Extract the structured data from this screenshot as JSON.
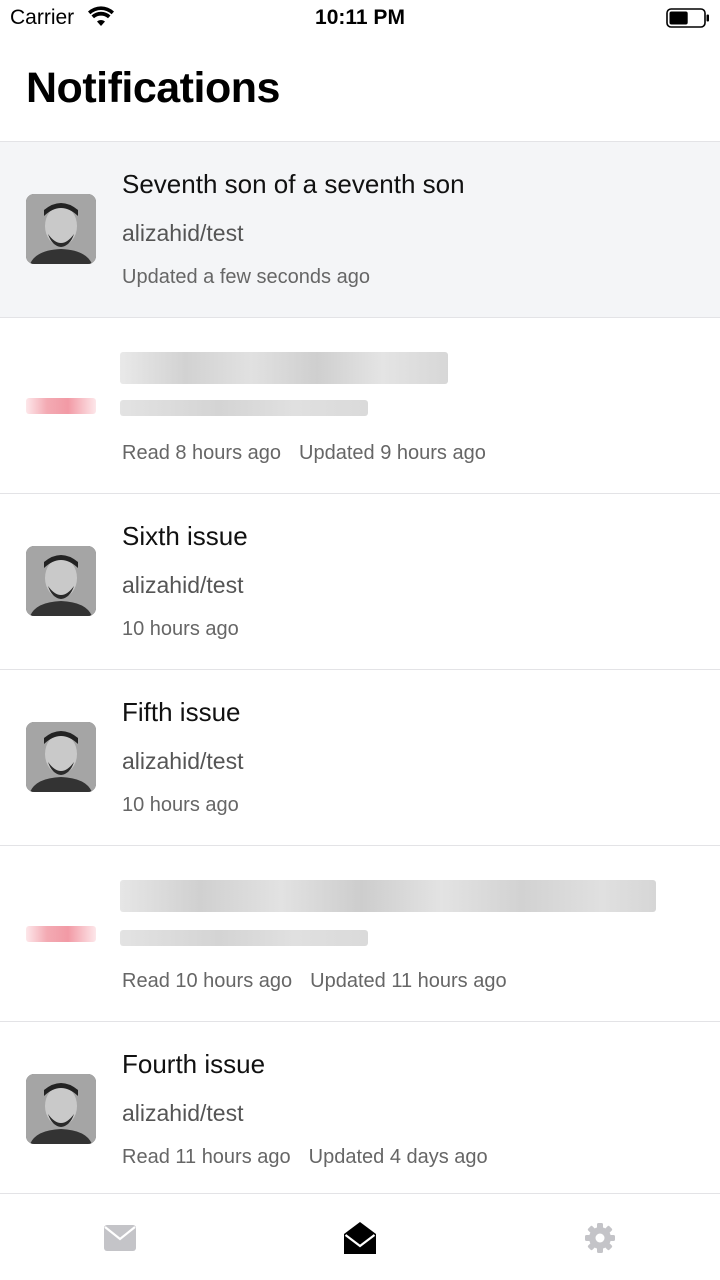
{
  "status_bar": {
    "carrier": "Carrier",
    "time": "10:11 PM",
    "battery_level": 0.55
  },
  "page": {
    "title": "Notifications"
  },
  "notifications": [
    {
      "title": "Seventh son of a seventh son",
      "repo": "alizahid/test",
      "meta_primary": "Updated a few seconds ago",
      "meta_secondary": "",
      "unread": true
    },
    {
      "title": "",
      "repo": "",
      "meta_primary": "Read 8 hours ago",
      "meta_secondary": "Updated 9 hours ago",
      "unread": false,
      "redacted": true
    },
    {
      "title": "Sixth issue",
      "repo": "alizahid/test",
      "meta_primary": "10 hours ago",
      "meta_secondary": "",
      "unread": false
    },
    {
      "title": "Fifth issue",
      "repo": "alizahid/test",
      "meta_primary": "10 hours ago",
      "meta_secondary": "",
      "unread": false
    },
    {
      "title": "",
      "repo": "",
      "meta_primary": "Read 10 hours ago",
      "meta_secondary": "Updated 11 hours ago",
      "unread": false,
      "redacted": true
    },
    {
      "title": "Fourth issue",
      "repo": "alizahid/test",
      "meta_primary": "Read 11 hours ago",
      "meta_secondary": "Updated 4 days ago",
      "unread": false
    }
  ],
  "tab_bar": {
    "tabs": [
      {
        "icon": "mail-closed-icon",
        "active": false
      },
      {
        "icon": "mail-open-icon",
        "active": true
      },
      {
        "icon": "gear-icon",
        "active": false
      }
    ],
    "active_color": "#000000",
    "inactive_color": "#c4c4c8"
  },
  "colors": {
    "unread_background": "#f4f5f7",
    "divider": "#e3e3e6"
  }
}
